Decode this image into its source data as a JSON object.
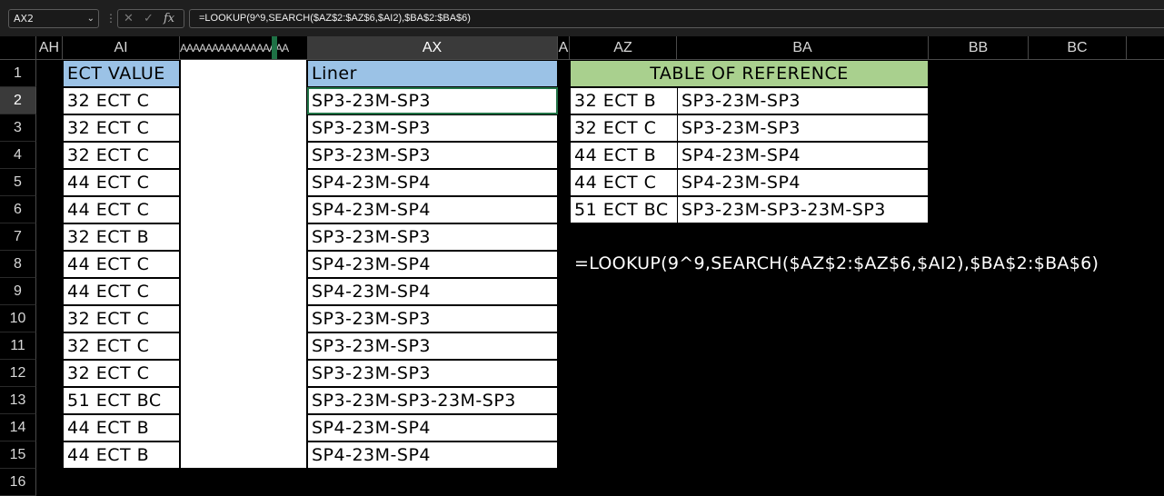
{
  "formula_bar": {
    "name_box": "AX2",
    "formula": "=LOOKUP(9^9,SEARCH($AZ$2:$AZ$6,$AI2),$BA$2:$BA$6)",
    "cancel_glyph": "✕",
    "enter_glyph": "✓",
    "fx_glyph": "fx"
  },
  "columns": {
    "ah": "AH",
    "ai": "AI",
    "hidden_run": "AAAAAAAAAAAAAAAAA",
    "ax": "AX",
    "a_narrow": "A",
    "az": "AZ",
    "ba": "BA",
    "bb": "BB",
    "bc": "BC"
  },
  "rows": [
    "1",
    "2",
    "3",
    "4",
    "5",
    "6",
    "7",
    "8",
    "9",
    "10",
    "11",
    "12",
    "13",
    "14",
    "15",
    "16"
  ],
  "ai_header": "ECT VALUE",
  "ax_header": "Liner",
  "ai_values": [
    "32 ECT C",
    "32 ECT C",
    "32 ECT C",
    "44 ECT C",
    "44 ECT C",
    "32 ECT B",
    "44 ECT C",
    "44 ECT C",
    "32 ECT C",
    "32 ECT C",
    "32 ECT C",
    "51 ECT BC",
    "44 ECT B",
    "44 ECT B"
  ],
  "ax_values": [
    "SP3-23M-SP3",
    "SP3-23M-SP3",
    "SP3-23M-SP3",
    "SP4-23M-SP4",
    "SP4-23M-SP4",
    "SP3-23M-SP3",
    "SP4-23M-SP4",
    "SP4-23M-SP4",
    "SP3-23M-SP3",
    "SP3-23M-SP3",
    "SP3-23M-SP3",
    "SP3-23M-SP3-23M-SP3",
    "SP4-23M-SP4",
    "SP4-23M-SP4"
  ],
  "reference_table": {
    "title": "TABLE OF REFERENCE",
    "keys": [
      "32 ECT B",
      "32 ECT C",
      "44 ECT B",
      "44 ECT C",
      "51 ECT BC"
    ],
    "values": [
      "SP3-23M-SP3",
      "SP3-23M-SP3",
      "SP4-23M-SP4",
      "SP4-23M-SP4",
      "SP3-23M-SP3-23M-SP3"
    ]
  },
  "formula_note": "=LOOKUP(9^9,SEARCH($AZ$2:$AZ$6,$AI2),$BA$2:$BA$6)",
  "colors": {
    "ai_header_bg": "#9bc2e6",
    "ref_header_bg": "#a9d08e",
    "selection": "#217346"
  }
}
